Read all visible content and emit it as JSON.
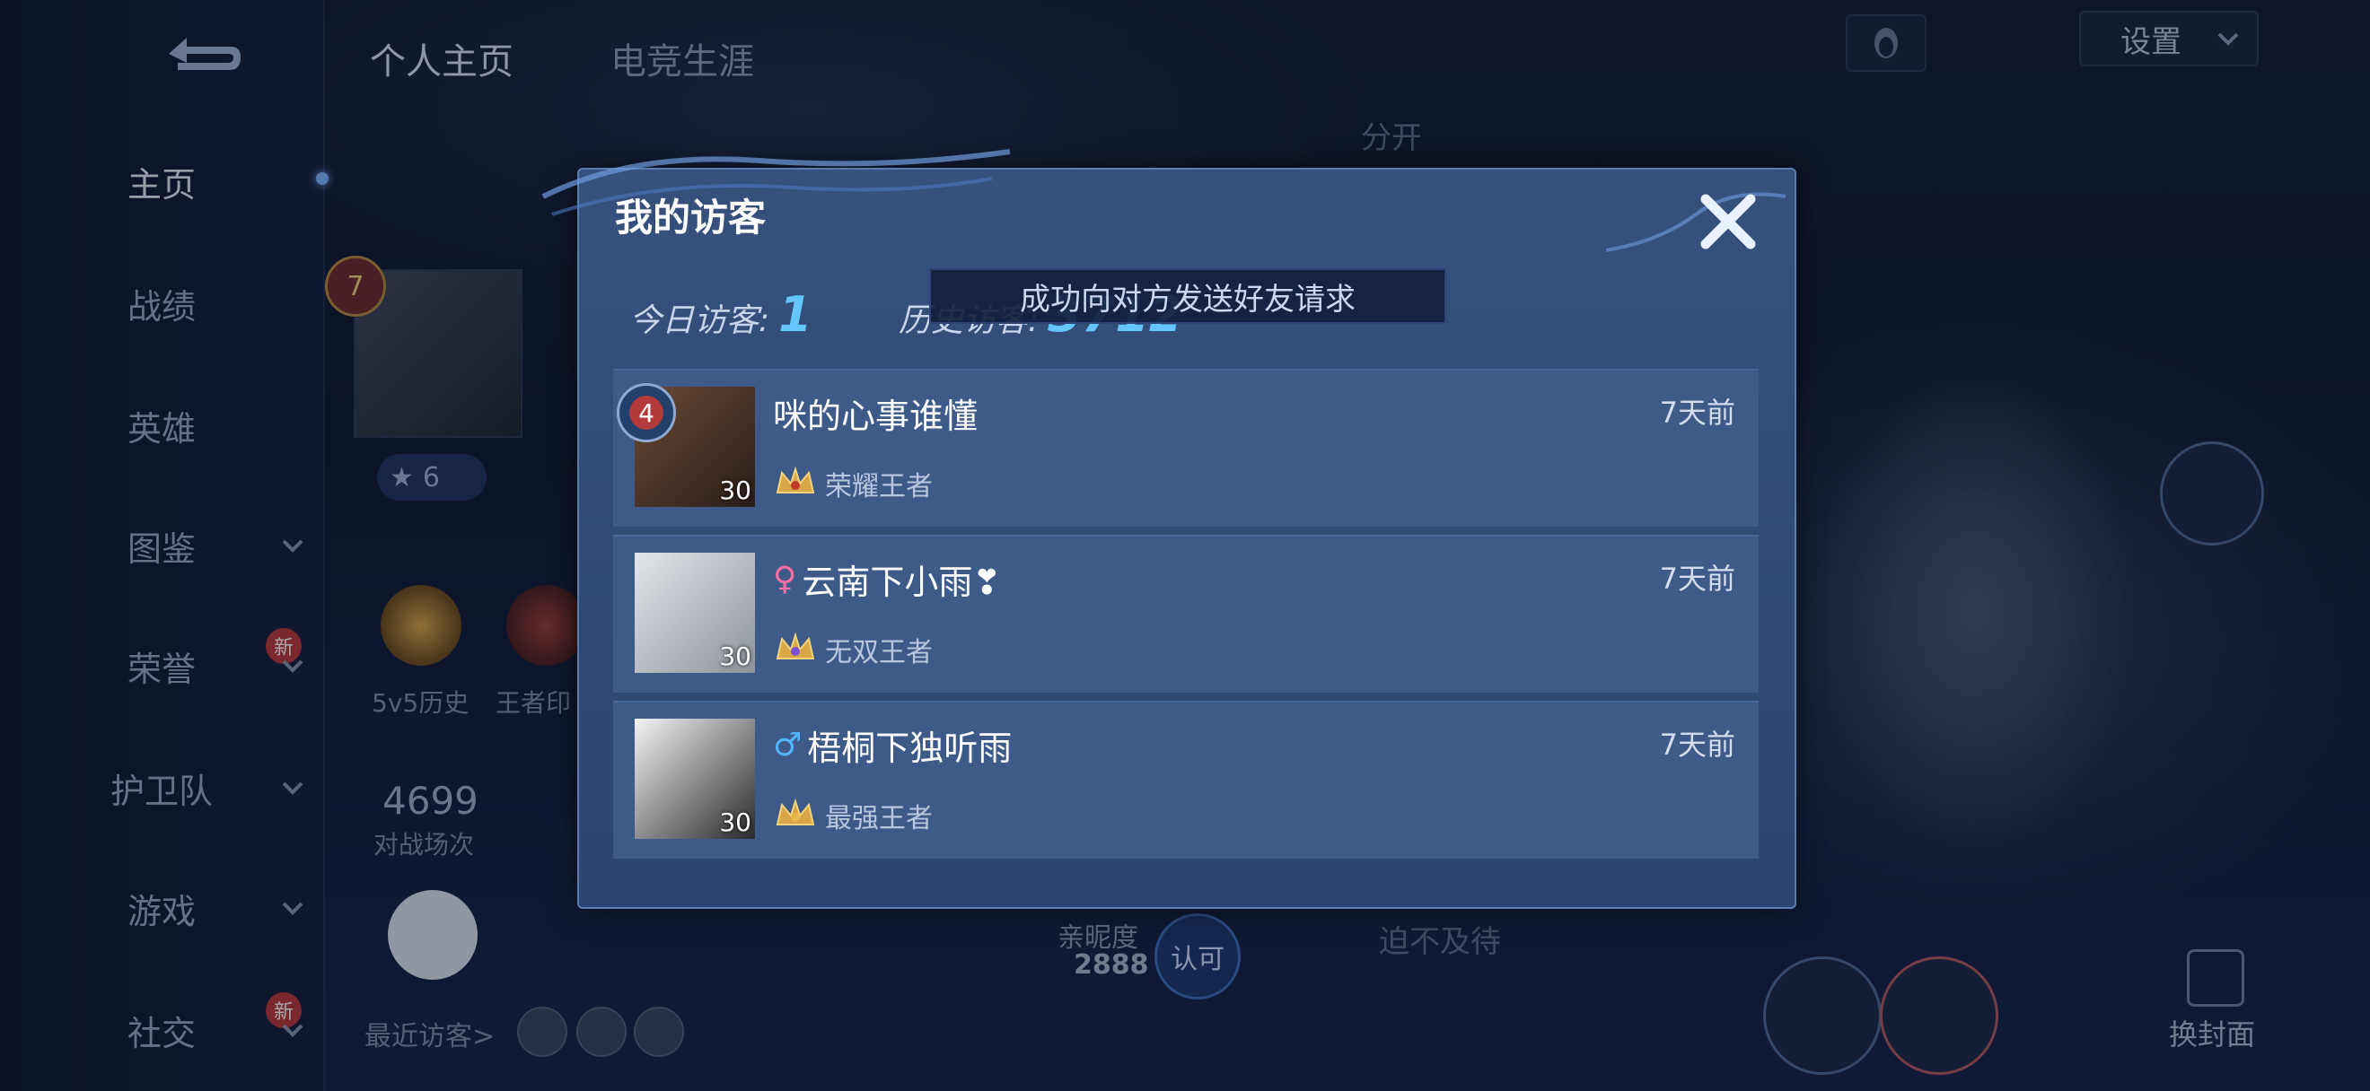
{
  "sidebar": {
    "items": [
      {
        "label": "主页",
        "chevron": false,
        "new": false
      },
      {
        "label": "战绩",
        "chevron": false,
        "new": false
      },
      {
        "label": "英雄",
        "chevron": false,
        "new": false
      },
      {
        "label": "图鉴",
        "chevron": true,
        "new": false
      },
      {
        "label": "荣誉",
        "chevron": true,
        "new": true
      },
      {
        "label": "护卫队",
        "chevron": true,
        "new": false
      },
      {
        "label": "游戏",
        "chevron": true,
        "new": false
      },
      {
        "label": "社交",
        "chevron": true,
        "new": true
      }
    ],
    "new_badge": "新"
  },
  "header": {
    "tabs": [
      "个人主页",
      "电竞生涯"
    ],
    "settings_label": "设置"
  },
  "background": {
    "level": "7",
    "rank_stars": "6",
    "emblem_labels": [
      "5v5历史",
      "王者印"
    ],
    "emblem_badge": "7",
    "matches_value": "4699",
    "matches_label": "对战场次",
    "recent_visitors": "最近访客>",
    "fragment_top": "分开",
    "intimacy_label": "亲昵度",
    "intimacy_value": "2888",
    "confirm_label": "认可",
    "fragment_bottom": "迫不及待",
    "cover_label": "换封面"
  },
  "modal": {
    "title": "我的访客",
    "today_label": "今日访客:",
    "today_value": "1",
    "history_label": "历史访客:",
    "history_value": "3712",
    "toast": "成功向对方发送好友请求",
    "visitors": [
      {
        "name": "咪的心事谁懂",
        "gender": "",
        "time": "7天前",
        "tier": "荣耀王者",
        "level": "30",
        "rank_badge": "4"
      },
      {
        "name": "云南下小雨❣",
        "gender": "♀",
        "time": "7天前",
        "tier": "无双王者",
        "level": "30",
        "rank_badge": ""
      },
      {
        "name": "梧桐下独听雨",
        "gender": "♂",
        "time": "7天前",
        "tier": "最强王者",
        "level": "30",
        "rank_badge": ""
      }
    ]
  },
  "colors": {
    "accent_number": "#65c6ff",
    "female": "#ff6fa3",
    "male": "#53b4ff",
    "modal_bg": "#36517d"
  }
}
